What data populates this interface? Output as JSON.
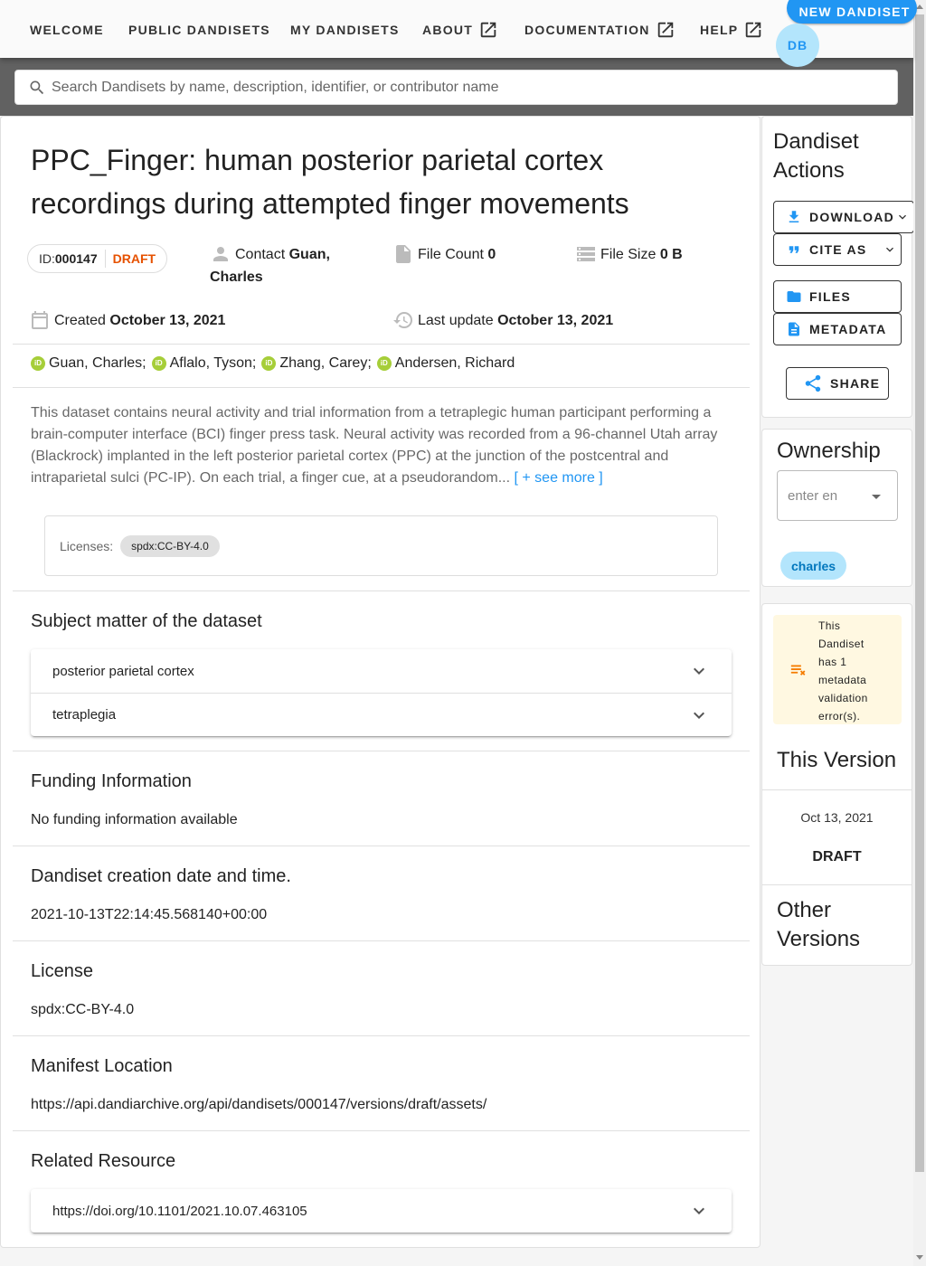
{
  "nav": {
    "welcome": "WELCOME",
    "public_dandisets": "PUBLIC DANDISETS",
    "my_dandisets": "MY DANDISETS",
    "about": "ABOUT",
    "documentation": "DOCUMENTATION",
    "help": "HELP",
    "new_dandiset": "NEW DANDISET",
    "avatar_initials": "DB"
  },
  "search": {
    "placeholder": "Search Dandisets by name, description, identifier, or contributor name"
  },
  "dandiset": {
    "title": "PPC_Finger: human posterior parietal cortex recordings during attempted finger movements",
    "id_label": "ID:",
    "id": "000147",
    "status": "DRAFT",
    "contact_label": "Contact",
    "contact_name": "Guan, Charles",
    "file_count_label": "File Count",
    "file_count": "0",
    "file_size_label": "File Size",
    "file_size": "0 B",
    "created_label": "Created",
    "created": "October 13, 2021",
    "last_update_label": "Last update",
    "last_update": "October 13, 2021",
    "contributors": [
      "Guan, Charles;",
      "Aflalo, Tyson;",
      "Zhang, Carey;",
      "Andersen, Richard"
    ],
    "description": "This dataset contains neural activity and trial information from a tetraplegic human participant performing a brain-computer interface (BCI) finger press task. Neural activity was recorded from a 96-channel Utah array (Blackrock) implanted in the left posterior parietal cortex (PPC) at the junction of the postcentral and intraparietal sulci (PC-IP). On each trial, a finger cue, at a pseudorandom...",
    "see_more": "[ + see more ]",
    "licenses_label": "Licenses:",
    "license_chip": "spdx:CC-BY-4.0"
  },
  "sections": {
    "subject_matter": {
      "title": "Subject matter of the dataset",
      "items": [
        "posterior parietal cortex",
        "tetraplegia"
      ]
    },
    "funding": {
      "title": "Funding Information",
      "text": "No funding information available"
    },
    "creation": {
      "title": "Dandiset creation date and time.",
      "text": "2021-10-13T22:14:45.568140+00:00"
    },
    "license": {
      "title": "License",
      "text": "spdx:CC-BY-4.0"
    },
    "manifest": {
      "title": "Manifest Location",
      "text": "https://api.dandiarchive.org/api/dandisets/000147/versions/draft/assets/"
    },
    "related": {
      "title": "Related Resource",
      "items": [
        "https://doi.org/10.1101/2021.10.07.463105"
      ]
    }
  },
  "sidebar": {
    "actions_title": "Dandiset Actions",
    "download": "DOWNLOAD",
    "cite_as": "CITE AS",
    "files": "FILES",
    "metadata": "METADATA",
    "share": "SHARE",
    "ownership_title": "Ownership",
    "owner_placeholder": "enter en",
    "owner_chip": "charles",
    "validation_warning": "This Dandiset has 1 metadata validation error(s).",
    "this_version_title": "This Version",
    "version_date": "Oct 13, 2021",
    "version_status": "DRAFT",
    "other_versions_title": "Other Versions"
  },
  "colors": {
    "primary": "#2196f3",
    "draft": "#e65100",
    "search_strip": "#616161",
    "warning_bg": "#fff8e1",
    "warning_icon": "#f57c00",
    "orcid": "#a6ce39"
  }
}
